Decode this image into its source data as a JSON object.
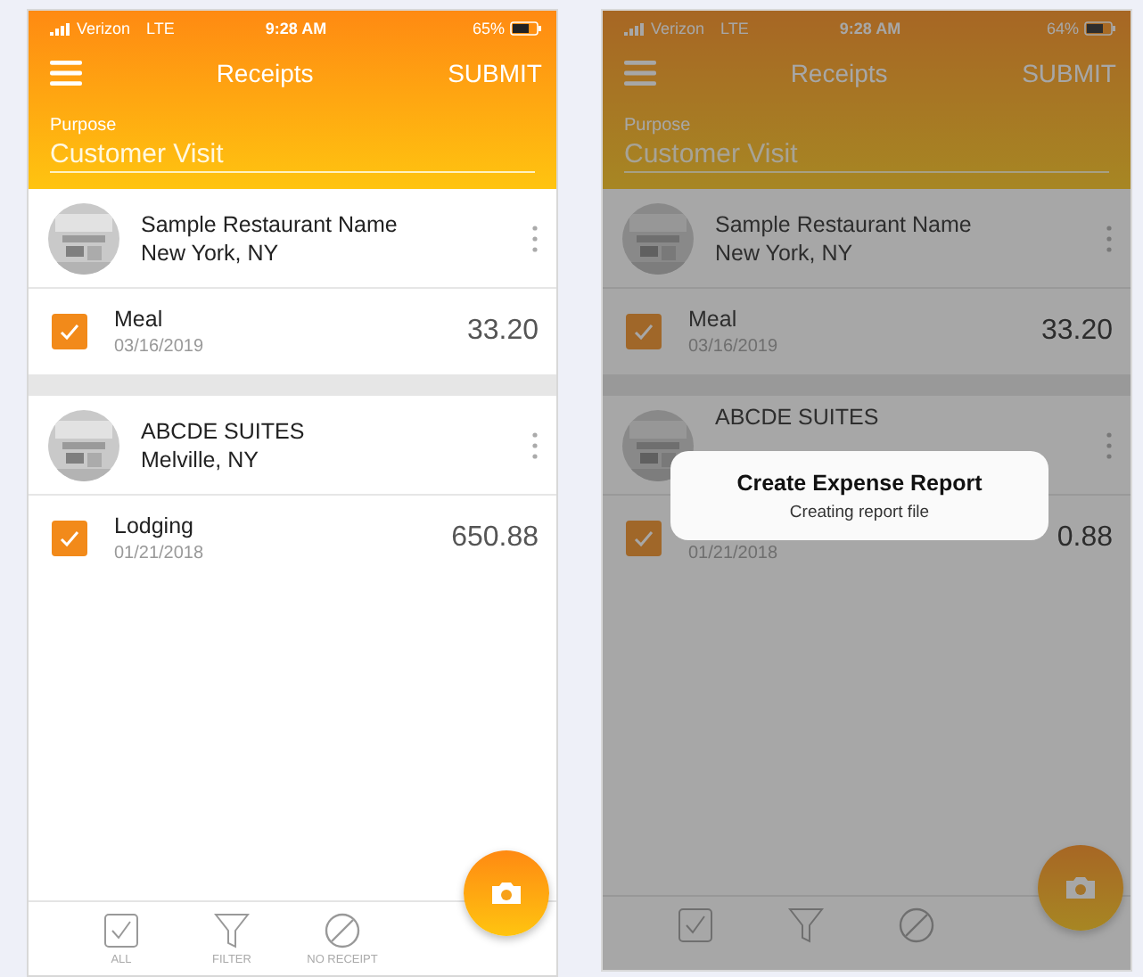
{
  "screens": [
    {
      "dimmed": false,
      "status_bar": {
        "carrier": "Verizon",
        "network": "LTE",
        "time": "9:28 AM",
        "battery": "65%"
      },
      "nav": {
        "title": "Receipts",
        "action": "SUBMIT"
      },
      "purpose": {
        "label": "Purpose",
        "value": "Customer Visit"
      },
      "receipts": [
        {
          "merchant": "Sample Restaurant Name",
          "location": "New York, NY",
          "expense": {
            "category": "Meal",
            "date": "03/16/2019",
            "amount": "33.20",
            "checked": true
          }
        },
        {
          "merchant": "ABCDE SUITES",
          "location": "Melville, NY",
          "expense": {
            "category": "Lodging",
            "date": "01/21/2018",
            "amount": "650.88",
            "checked": true
          }
        }
      ],
      "tabs": [
        {
          "kind": "check",
          "label": "ALL"
        },
        {
          "kind": "filter",
          "label": "FILTER"
        },
        {
          "kind": "none",
          "label": "NO RECEIPT"
        }
      ]
    },
    {
      "dimmed": true,
      "status_bar": {
        "carrier": "Verizon",
        "network": "LTE",
        "time": "9:28 AM",
        "battery": "64%"
      },
      "nav": {
        "title": "Receipts",
        "action": "SUBMIT"
      },
      "purpose": {
        "label": "Purpose",
        "value": "Customer Visit"
      },
      "receipts": [
        {
          "merchant": "Sample Restaurant Name",
          "location": "New York, NY",
          "expense": {
            "category": "Meal",
            "date": "03/16/2019",
            "amount": "33.20",
            "checked": true
          }
        },
        {
          "merchant": "ABCDE SUITES",
          "expense": {
            "date": "01/21/2018",
            "amount": "0.88",
            "checked": true
          }
        }
      ],
      "tabs": [
        {
          "kind": "check"
        },
        {
          "kind": "filter"
        },
        {
          "kind": "none"
        }
      ],
      "dialog": {
        "title": "Create Expense Report",
        "message": "Creating report file"
      }
    }
  ]
}
